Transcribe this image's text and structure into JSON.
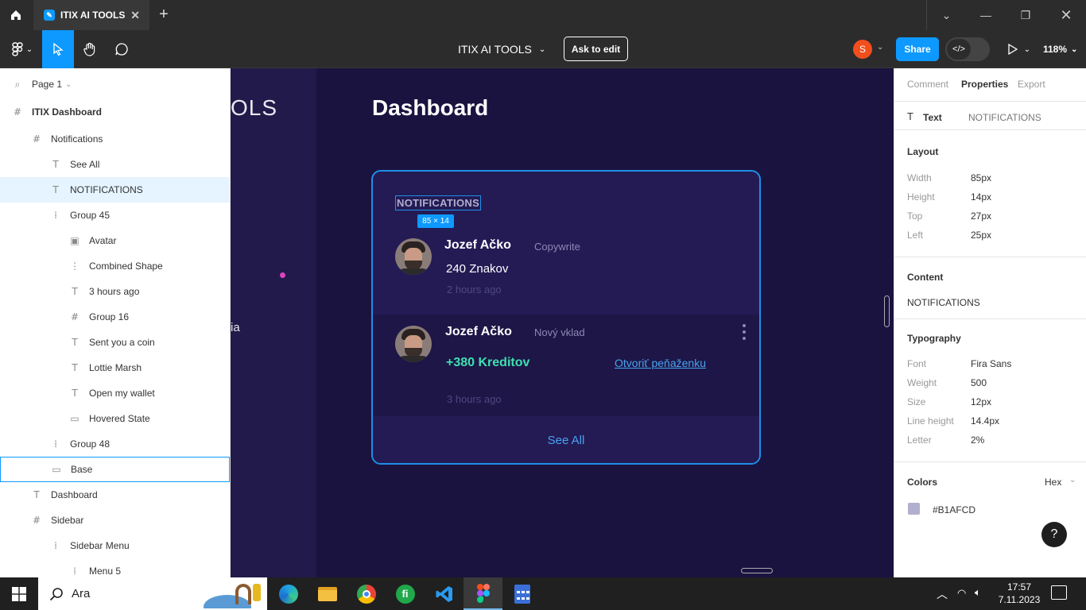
{
  "titlebar": {
    "tab_title": "ITIX AI TOOLS",
    "new_tab": "+"
  },
  "toolbar": {
    "file_name": "ITIX AI TOOLS",
    "ask_to_edit": "Ask to edit",
    "avatar_initial": "S",
    "share": "Share",
    "zoom": "118%"
  },
  "layers": {
    "page": "Page 1",
    "items": [
      {
        "label": "ITIX Dashboard",
        "icon": "frame-icon"
      },
      {
        "label": "Notifications",
        "icon": "frame-icon"
      },
      {
        "label": "See All",
        "icon": "text-icon"
      },
      {
        "label": "NOTIFICATIONS",
        "icon": "text-icon"
      },
      {
        "label": "Group 45",
        "icon": "group-icon"
      },
      {
        "label": "Avatar",
        "icon": "image-icon"
      },
      {
        "label": "Combined Shape",
        "icon": "vector-icon"
      },
      {
        "label": "3 hours ago",
        "icon": "text-icon"
      },
      {
        "label": "Group 16",
        "icon": "frame-icon"
      },
      {
        "label": "Sent you a coin",
        "icon": "text-icon"
      },
      {
        "label": "Lottie Marsh",
        "icon": "text-icon"
      },
      {
        "label": "Open my wallet",
        "icon": "text-icon"
      },
      {
        "label": "Hovered State",
        "icon": "rectangle-icon"
      },
      {
        "label": "Group 48",
        "icon": "group-icon"
      },
      {
        "label": "Base",
        "icon": "rectangle-icon"
      },
      {
        "label": "Dashboard",
        "icon": "text-icon"
      },
      {
        "label": "Sidebar",
        "icon": "frame-icon"
      },
      {
        "label": "Sidebar Menu",
        "icon": "group-icon"
      },
      {
        "label": "Menu 5",
        "icon": "group-icon"
      }
    ]
  },
  "canvas": {
    "logo_fragment": "OLS",
    "side_fragment": "ia",
    "page_title": "Dashboard",
    "card": {
      "label": "NOTIFICATIONS",
      "size_badge": "85 × 14",
      "notifications": [
        {
          "name": "Jozef Ačko",
          "type": "Copywrite",
          "amount": "240 Znakov",
          "time": "2 hours ago"
        },
        {
          "name": "Jozef Ačko",
          "type": "Nový vklad",
          "amount": "+380 Kreditov",
          "action": "Otvoriť peňaženku",
          "time": "3 hours ago"
        }
      ],
      "see_all": "See All"
    }
  },
  "properties": {
    "tabs": [
      "Comment",
      "Properties",
      "Export"
    ],
    "selection_type": "Text",
    "selection_name": "NOTIFICATIONS",
    "layout": {
      "title": "Layout",
      "rows": [
        {
          "k": "Width",
          "v": "85px"
        },
        {
          "k": "Height",
          "v": "14px"
        },
        {
          "k": "Top",
          "v": "27px"
        },
        {
          "k": "Left",
          "v": "25px"
        }
      ]
    },
    "content": {
      "title": "Content",
      "value": "NOTIFICATIONS"
    },
    "typography": {
      "title": "Typography",
      "rows": [
        {
          "k": "Font",
          "v": "Fira Sans"
        },
        {
          "k": "Weight",
          "v": "500"
        },
        {
          "k": "Size",
          "v": "12px"
        },
        {
          "k": "Line height",
          "v": "14.4px"
        },
        {
          "k": "Letter",
          "v": "2%"
        }
      ]
    },
    "colors": {
      "title": "Colors",
      "format": "Hex",
      "swatch": "#B1AFCD",
      "value": "#B1AFCD"
    }
  },
  "taskbar": {
    "search": "Ara",
    "time": "17:57",
    "date": "7.11.2023"
  },
  "colors": {
    "accent": "#0d99ff",
    "canvas_bg": "#1a1340",
    "card_border": "#1e8fe6",
    "credit_green": "#3ee0b0",
    "link_blue": "#4aa3f0"
  }
}
